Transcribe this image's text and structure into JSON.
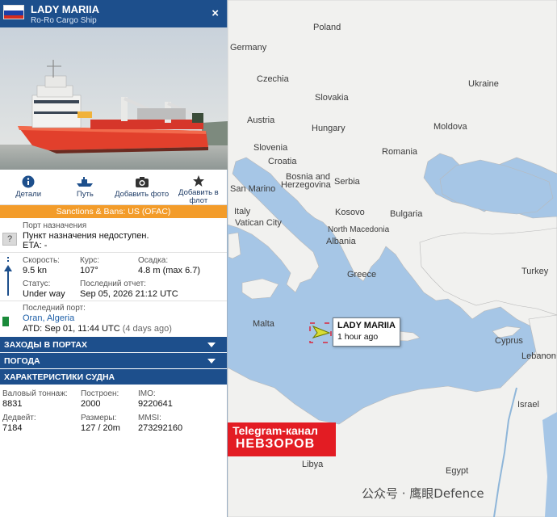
{
  "header": {
    "ship_name": "LADY MARIIA",
    "ship_type": "Ro-Ro Cargo Ship",
    "close_glyph": "×",
    "flag_colors": [
      "#ffffff",
      "#1c3fa8",
      "#d52b1e"
    ]
  },
  "toolbar": {
    "items": [
      {
        "label": "Детали",
        "icon": "info-icon"
      },
      {
        "label": "Путь",
        "icon": "ship-route-icon"
      },
      {
        "label": "Добавить фото",
        "icon": "camera-icon"
      },
      {
        "label": "Добавить в флот",
        "icon": "star-icon"
      }
    ]
  },
  "sanctions": {
    "text": "Sanctions & Bans: US (OFAC)"
  },
  "destination": {
    "label": "Порт назначения",
    "value": "Пункт назначения недоступен.",
    "eta": "ETA: -",
    "unknown_glyph": "?"
  },
  "motion": {
    "speed_label": "Скорость:",
    "speed_value": "9.5 kn",
    "course_label": "Курс:",
    "course_value": "107°",
    "draught_label": "Осадка:",
    "draught_value": "4.8 m (max 6.7)"
  },
  "status": {
    "status_label": "Статус:",
    "status_value": "Under way",
    "report_label": "Последний отчет:",
    "report_value": "Sep 05, 2026 21:12 UTC"
  },
  "last_port": {
    "label": "Последний порт:",
    "name": "Oran, Algeria",
    "atd": "ATD: Sep 01, 11:44 UTC",
    "ago": "(4 days ago)",
    "flag_colors": [
      "#1a8a3a",
      "#ffffff",
      "#d52b1e"
    ]
  },
  "sections": [
    {
      "label": "ЗАХОДЫ В ПОРТАХ"
    },
    {
      "label": "ПОГОДА"
    },
    {
      "label": "ХАРАКТЕРИСТИКИ СУДНА"
    }
  ],
  "specs": {
    "gt_label": "Валовый тоннаж:",
    "gt_value": "8831",
    "built_label": "Построен:",
    "built_value": "2000",
    "imo_label": "IMO:",
    "imo_value": "9220641",
    "dwt_label": "Дедвейт:",
    "dwt_value": "7184",
    "size_label": "Размеры:",
    "size_value": "127 / 20m",
    "mmsi_label": "MMSI:",
    "mmsi_value": "273292160"
  },
  "map": {
    "countries": [
      "Poland",
      "Germany",
      "Czechia",
      "Slovakia",
      "Ukraine",
      "Austria",
      "Hungary",
      "Moldova",
      "Slovenia",
      "Romania",
      "Croatia",
      "Bosnia and",
      "Herzegovina",
      "San Marino",
      "Serbia",
      "Italy",
      "Vatican City",
      "Kosovo",
      "Bulgaria",
      "North Macedonia",
      "Albania",
      "Turkey",
      "Greece",
      "Malta",
      "Cyprus",
      "Lebanon",
      "Israel",
      "Libya",
      "Egypt"
    ],
    "sea_color": "#a6c6e6",
    "land_color": "#f1f1ef"
  },
  "vessel_popup": {
    "name": "LADY MARIIA",
    "time": "1 hour ago"
  },
  "overlay": {
    "telegram_line1": "Telegram-канал",
    "telegram_line2": "НЕВЗОРОВ",
    "watermark": "公众号 · 鹰眼Defence"
  }
}
